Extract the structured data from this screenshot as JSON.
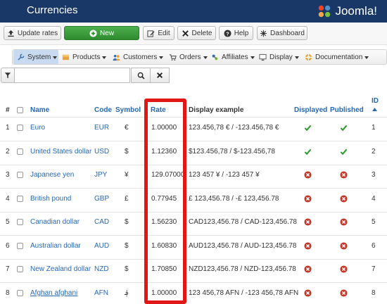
{
  "header": {
    "title": "Currencies",
    "brand": "Joomla!"
  },
  "toolbar": {
    "update_rates": "Update rates",
    "new": "New",
    "edit": "Edit",
    "delete": "Delete",
    "help": "Help",
    "dashboard": "Dashboard"
  },
  "menu": {
    "system": "System",
    "products": "Products",
    "customers": "Customers",
    "orders": "Orders",
    "affiliates": "Affiliates",
    "display": "Display",
    "documentation": "Documentation"
  },
  "search": {
    "value": "",
    "placeholder": ""
  },
  "columns": {
    "num": "#",
    "name": "Name",
    "code": "Code",
    "symbol": "Symbol",
    "rate": "Rate",
    "display_example": "Display example",
    "displayed": "Displayed",
    "published": "Published",
    "id": "ID"
  },
  "rows": [
    {
      "num": "1",
      "name": "Euro",
      "code": "EUR",
      "symbol": "€",
      "rate": "1.00000",
      "example": "123.456,78 € / -123.456,78 €",
      "displayed": "yes",
      "published": "yes",
      "id": "1"
    },
    {
      "num": "2",
      "name": "United States dollar",
      "code": "USD",
      "symbol": "$",
      "rate": "1.12360",
      "example": "$123.456,78 / $-123.456,78",
      "displayed": "yes",
      "published": "yes",
      "id": "2"
    },
    {
      "num": "3",
      "name": "Japanese yen",
      "code": "JPY",
      "symbol": "¥",
      "rate": "129.07000",
      "example": "123 457 ¥ / -123 457 ¥",
      "displayed": "no",
      "published": "no",
      "id": "3"
    },
    {
      "num": "4",
      "name": "British pound",
      "code": "GBP",
      "symbol": "£",
      "rate": "0.77945",
      "example": "£ 123,456.78 / -£ 123,456.78",
      "displayed": "no",
      "published": "no",
      "id": "4"
    },
    {
      "num": "5",
      "name": "Canadian dollar",
      "code": "CAD",
      "symbol": "$",
      "rate": "1.56230",
      "example": "CAD123,456.78 / CAD-123,456.78",
      "displayed": "no",
      "published": "no",
      "id": "5"
    },
    {
      "num": "6",
      "name": "Australian dollar",
      "code": "AUD",
      "symbol": "$",
      "rate": "1.60830",
      "example": "AUD123,456.78 / AUD-123,456.78",
      "displayed": "no",
      "published": "no",
      "id": "6"
    },
    {
      "num": "7",
      "name": "New Zealand dollar",
      "code": "NZD",
      "symbol": "$",
      "rate": "1.70850",
      "example": "NZD123,456.78 / NZD-123,456.78",
      "displayed": "no",
      "published": "no",
      "id": "7"
    },
    {
      "num": "8",
      "name": "Afghan afghani",
      "code": "AFN",
      "symbol": "؋",
      "rate": "1.00000",
      "example": "123 456,78 AFN / -123 456,78 AFN",
      "displayed": "no",
      "published": "no",
      "id": "8"
    }
  ],
  "colors": {
    "header_bg": "#1a3867",
    "link": "#2767b2",
    "highlight": "#e11616",
    "yes": "#2f9a2f",
    "no": "#c0392b"
  }
}
